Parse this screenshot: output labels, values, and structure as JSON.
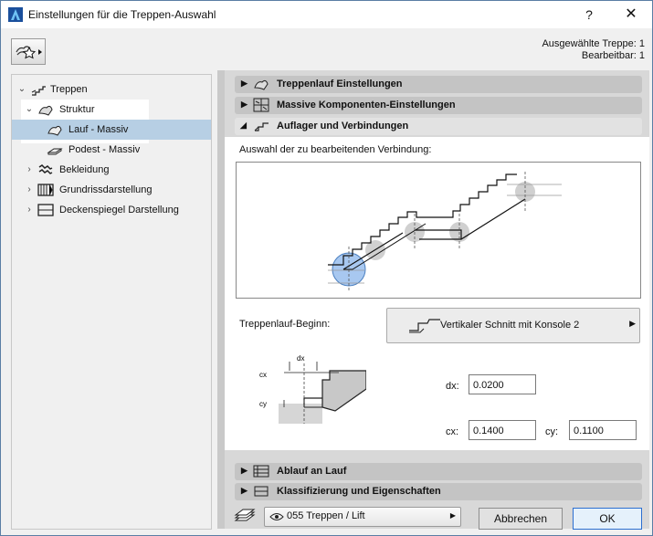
{
  "window": {
    "title": "Einstellungen für die Treppen-Auswahl",
    "help_label": "?",
    "close_label": "✕"
  },
  "selection_info": {
    "line1": "Ausgewählte Treppe: 1",
    "line2": "Bearbeitbar: 1"
  },
  "tree": {
    "items": [
      {
        "label": "Treppen",
        "icon": "stair-icon"
      },
      {
        "label": "Struktur",
        "icon": "structure-icon"
      },
      {
        "label": "Lauf - Massiv",
        "icon": "flight-icon"
      },
      {
        "label": "Podest - Massiv",
        "icon": "landing-icon"
      },
      {
        "label": "Bekleidung",
        "icon": "finish-icon"
      },
      {
        "label": "Grundrissdarstellung",
        "icon": "floorplan-icon"
      },
      {
        "label": "Deckenspiegel Darstellung",
        "icon": "ceiling-plan-icon"
      }
    ]
  },
  "sections": {
    "s1": "Treppenlauf Einstellungen",
    "s2": "Massive Komponenten-Einstellungen",
    "s3": "Auflager und Verbindungen",
    "s4": "Ablauf an Lauf",
    "s5": "Klassifizierung und Eigenschaften"
  },
  "content": {
    "connection_label": "Auswahl der zu bearbeitenden Verbindung:",
    "start_label": "Treppenlauf-Beginn:",
    "start_value": "Vertikaler Schnitt mit Konsole 2",
    "detail": {
      "dx": "dx",
      "cx": "cx",
      "cy": "cy"
    },
    "dx_label": "dx:",
    "dx_value": "0.0200",
    "cx_label": "cx:",
    "cx_value": "0.1400",
    "cy_label": "cy:",
    "cy_value": "0.1100"
  },
  "footer": {
    "layer_value": "055 Treppen / Lift",
    "cancel_label": "Abbrechen",
    "ok_label": "OK"
  },
  "colors": {
    "accent": "#2c6fd0",
    "selection": "#b7cfe4",
    "connector": "#a8c8f0"
  }
}
